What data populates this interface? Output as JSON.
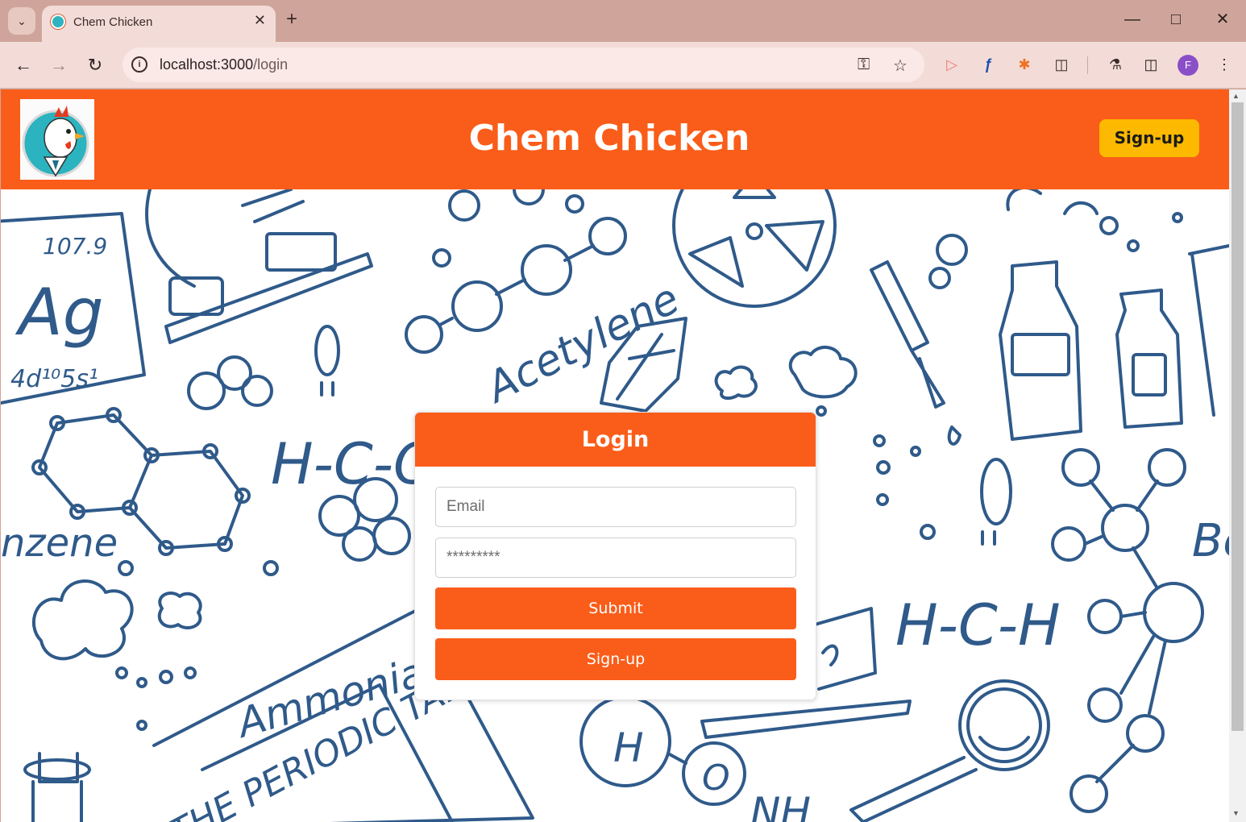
{
  "browser": {
    "tab": {
      "title": "Chem Chicken"
    },
    "url": {
      "host": "localhost:3000",
      "path": "/login"
    },
    "profile_initial": "F"
  },
  "header": {
    "title": "Chem Chicken",
    "signup_label": "Sign-up"
  },
  "login": {
    "title": "Login",
    "email_placeholder": "Email",
    "password_placeholder": "*********",
    "submit_label": "Submit",
    "signup_label": "Sign-up"
  },
  "background_text": {
    "element_mass": "107.9",
    "element_symbol": "Ag",
    "element_config": "4d¹⁰5s¹",
    "acetylene": "Acetylene",
    "benzene": "nzene",
    "ammonia": "Ammonia",
    "periodic_table": "THE PERIODIC TABLE",
    "hcoh_left": "H-C-OH",
    "hch_right": "H-C-H",
    "be": "Be",
    "nh": "NH",
    "h_atom": "H",
    "o_atom": "O",
    "oxygen_left": "O",
    "oxygen_right": "O"
  },
  "colors": {
    "brand": "#fa5d19",
    "accent": "#fcb900",
    "doodle": "#2f5a8a",
    "chrome": "#cfa59b"
  }
}
